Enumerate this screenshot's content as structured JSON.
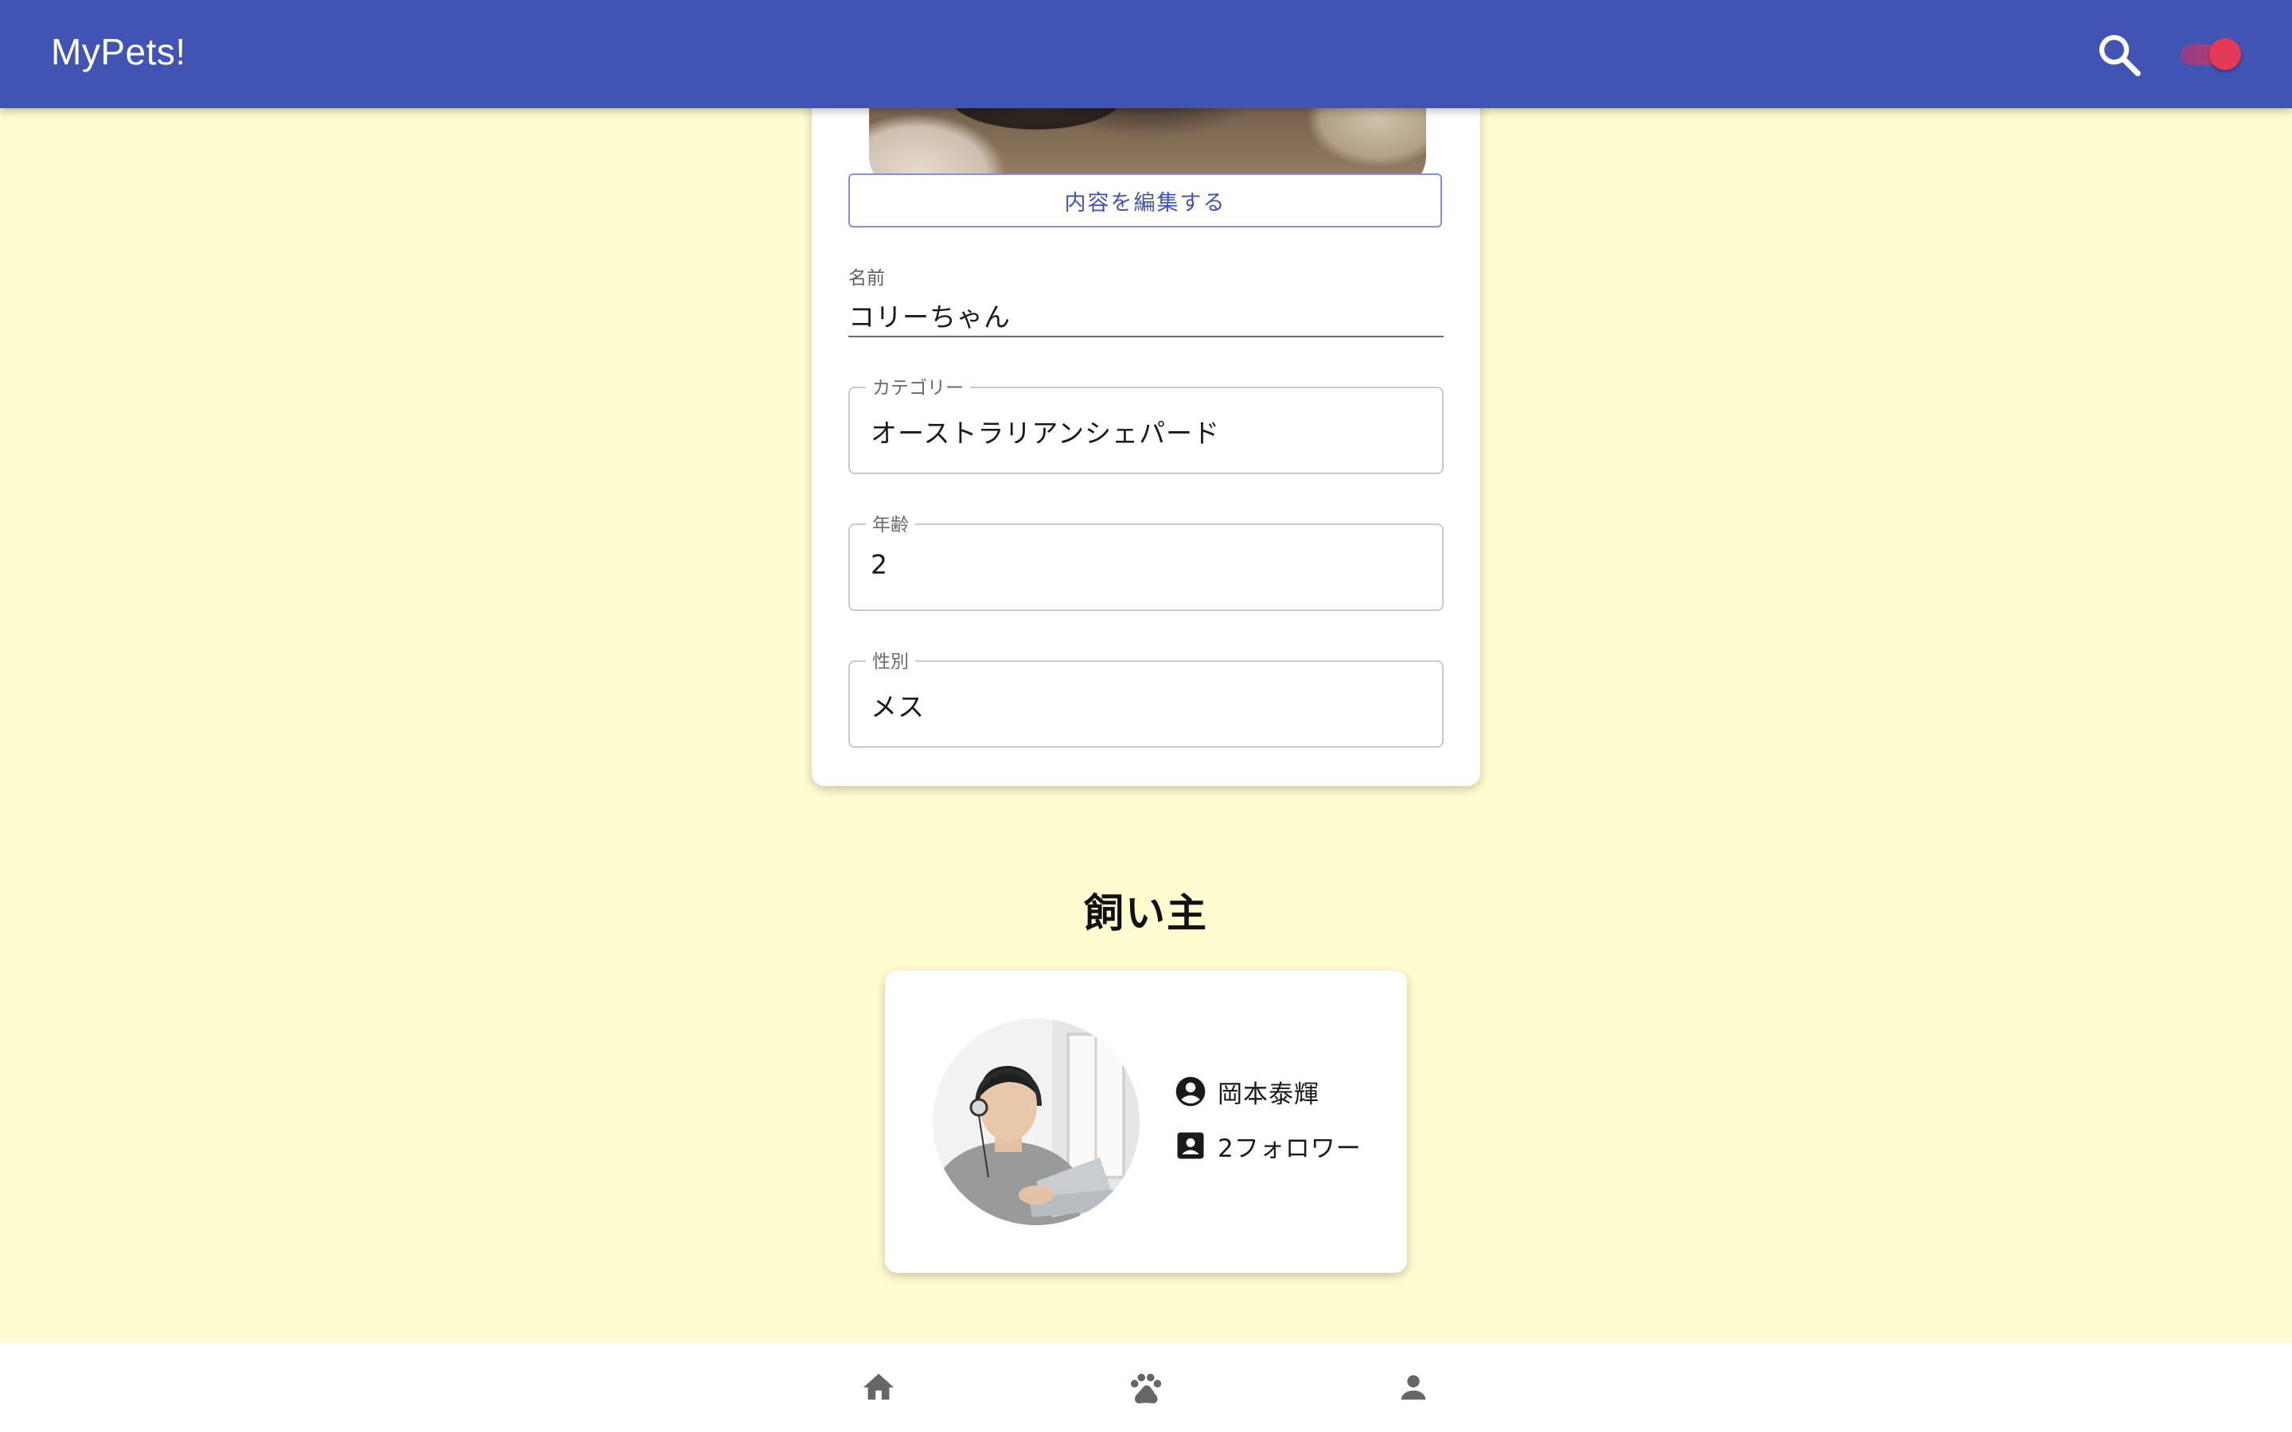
{
  "appbar": {
    "title": "MyPets!",
    "search_icon": "search-icon",
    "toggle_state": "on",
    "color": "#4153b3",
    "toggle_color": "#e53958"
  },
  "pet": {
    "photo_description": "dog-photo",
    "edit_button_label": "内容を編集する",
    "name_label": "名前",
    "name_value": "コリーちゃん",
    "category_label": "カテゴリー",
    "category_value": "オーストラリアンシェパード",
    "age_label": "年齢",
    "age_value": "2",
    "sex_label": "性別",
    "sex_value": "メス"
  },
  "owner": {
    "heading": "飼い主",
    "name": "岡本泰輝",
    "followers": "2フォロワー",
    "name_icon": "account-circle-icon",
    "followers_icon": "contact-card-icon"
  },
  "bottom_nav": {
    "items": [
      {
        "icon": "home-icon"
      },
      {
        "icon": "paw-icon"
      },
      {
        "icon": "person-icon"
      }
    ]
  },
  "colors": {
    "background": "#fffccf",
    "accent": "#4153b3"
  }
}
